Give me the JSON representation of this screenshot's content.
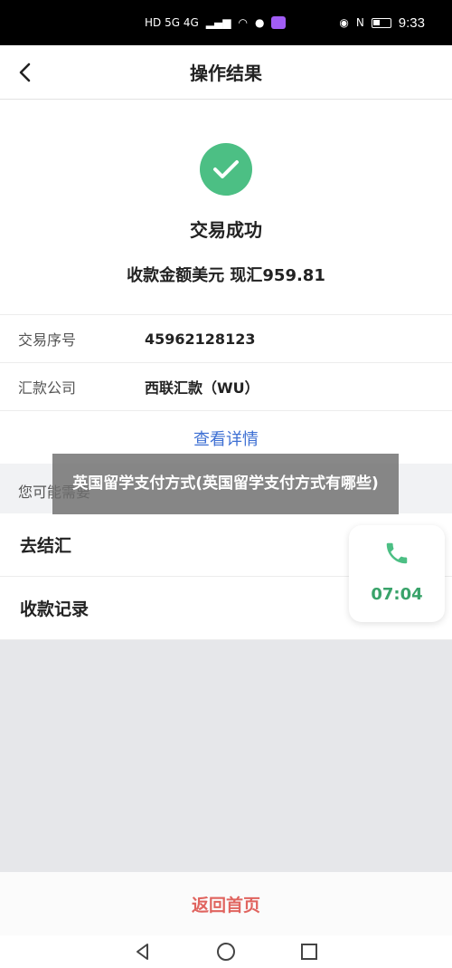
{
  "status_bar": {
    "network": "HD 5G 4G",
    "time": "9:33",
    "icons": [
      "signal-icon",
      "wifi-icon",
      "wechat-icon",
      "app-icon",
      "eye-icon",
      "nfc-icon",
      "battery-icon"
    ]
  },
  "header": {
    "title": "操作结果"
  },
  "result": {
    "title": "交易成功",
    "amount": "收款金额美元 现汇959.81",
    "accent_color": "#4cbf84"
  },
  "info": {
    "rows": [
      {
        "label": "交易序号",
        "value": "45962128123"
      },
      {
        "label": "汇款公司",
        "value": "西联汇款（WU）"
      }
    ],
    "view_details": "查看详情"
  },
  "suggest": {
    "label": "您可能需要",
    "items": [
      "去结汇",
      "收款记录"
    ]
  },
  "overlay": {
    "text": "英国留学支付方式(英国留学支付方式有哪些)"
  },
  "call_widget": {
    "time": "07:04"
  },
  "bottom": {
    "home_label": "返回首页"
  }
}
